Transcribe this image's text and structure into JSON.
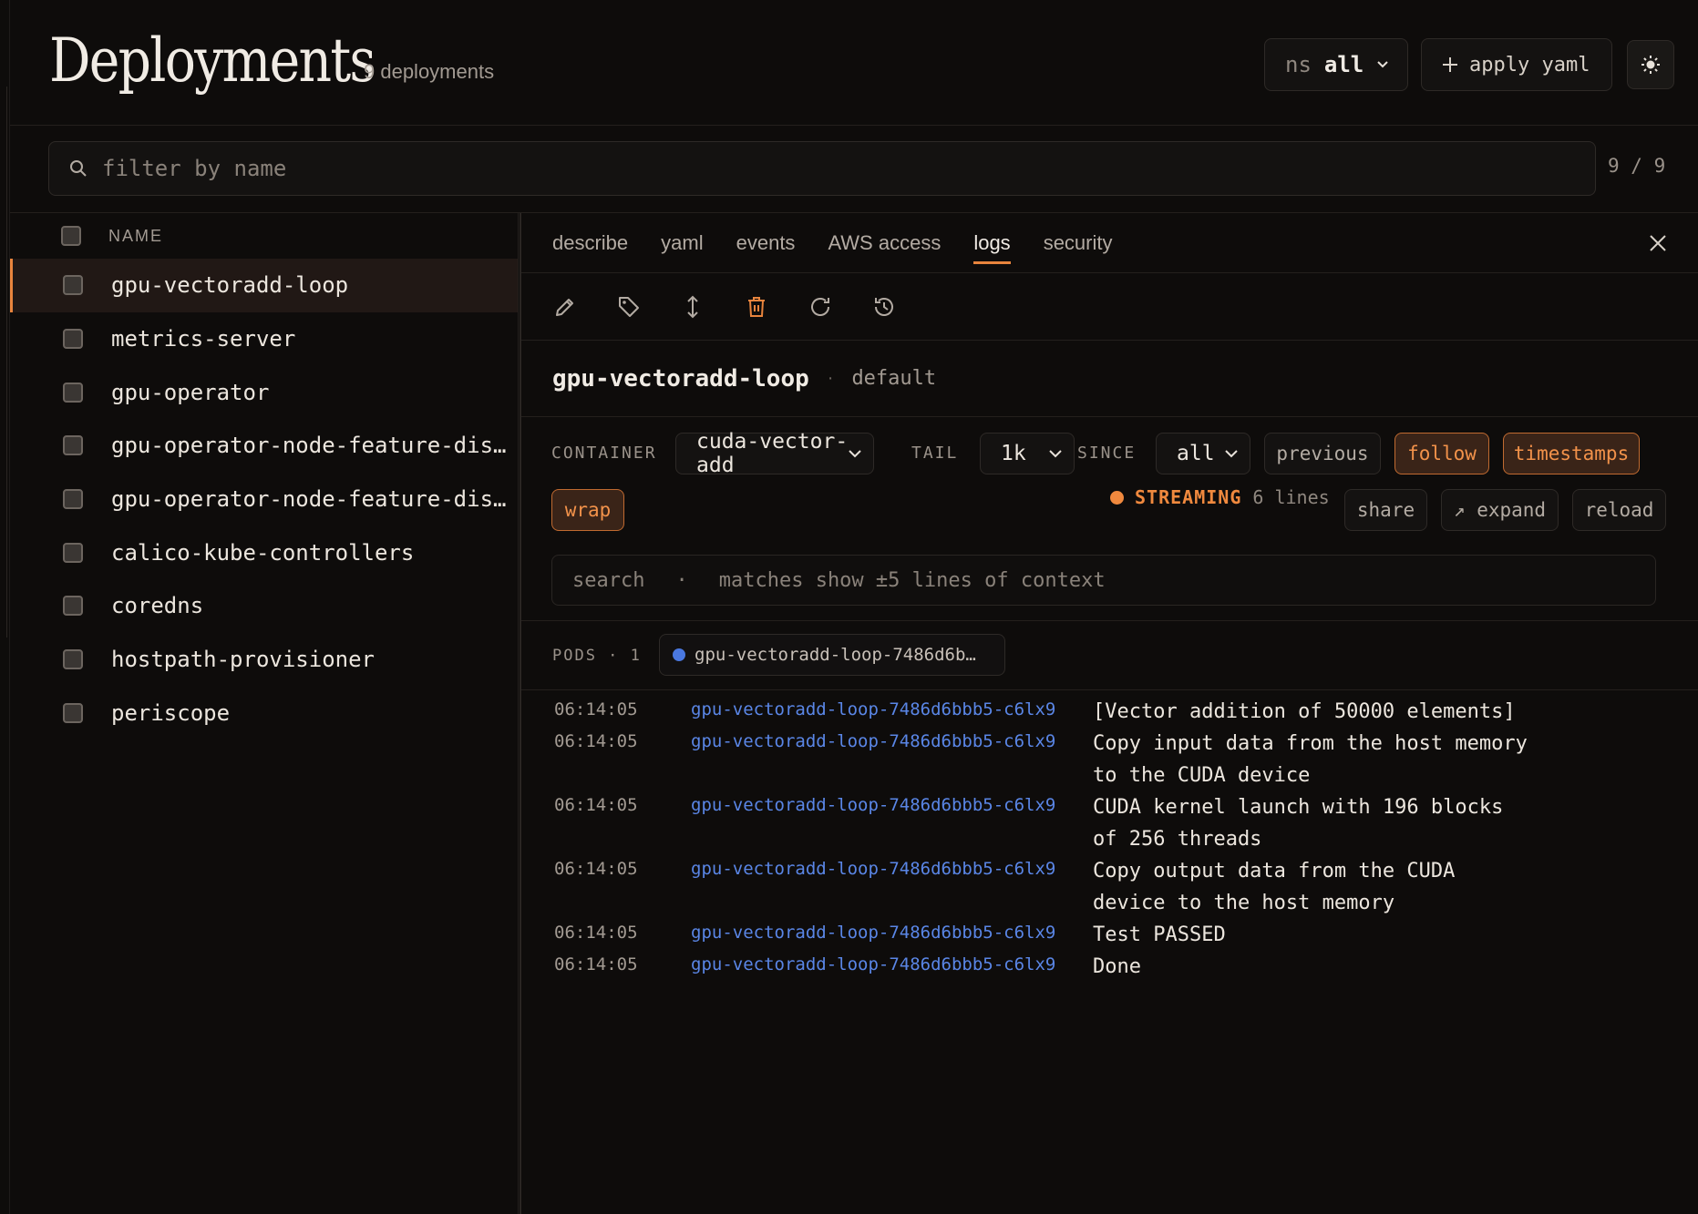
{
  "header": {
    "title": "Deployments",
    "count": "9 deployments",
    "ns_label": "ns",
    "ns_value": "all",
    "apply_label": "apply yaml",
    "theme_icon": "sun-icon"
  },
  "filter": {
    "placeholder": "filter by name",
    "count": "9 / 9"
  },
  "list": {
    "column": "NAME",
    "items": [
      {
        "label": "gpu-vectoradd-loop",
        "selected": true
      },
      {
        "label": "metrics-server"
      },
      {
        "label": "gpu-operator"
      },
      {
        "label": "gpu-operator-node-feature-disco…"
      },
      {
        "label": "gpu-operator-node-feature-disco…"
      },
      {
        "label": "calico-kube-controllers"
      },
      {
        "label": "coredns"
      },
      {
        "label": "hostpath-provisioner"
      },
      {
        "label": "periscope"
      }
    ]
  },
  "tabs": [
    "describe",
    "yaml",
    "events",
    "AWS access",
    "logs",
    "security"
  ],
  "active_tab": "logs",
  "toolbar": [
    "edit-icon",
    "tag-icon",
    "scale-icon",
    "delete-icon",
    "restart-icon",
    "history-icon"
  ],
  "resource": {
    "name": "gpu-vectoradd-loop",
    "sep": "·",
    "namespace": "default"
  },
  "controls": {
    "container_label": "CONTAINER",
    "container_value": "cuda-vector-add",
    "tail_label": "TAIL",
    "tail_value": "1k",
    "since_label": "SINCE",
    "since_value": "all",
    "previous": "previous",
    "follow": "follow",
    "timestamps": "timestamps",
    "wrap": "wrap",
    "streaming": "STREAMING",
    "lines": "6 lines",
    "share": "share",
    "expand": "↗ expand",
    "reload": "reload",
    "search_placeholder": "search",
    "search_sep": "·",
    "search_hint": "matches show ±5 lines of context"
  },
  "pods": {
    "label": "PODS · 1",
    "chip": "gpu-vectoradd-loop-7486d6b…"
  },
  "logs": [
    {
      "ts": "06:14:05",
      "pod": "gpu-vectoradd-loop-7486d6bbb5-c6lx9",
      "msg": "[Vector addition of 50000 elements]"
    },
    {
      "ts": "06:14:05",
      "pod": "gpu-vectoradd-loop-7486d6bbb5-c6lx9",
      "msg": "Copy input data from the host memory to the CUDA device"
    },
    {
      "ts": "06:14:05",
      "pod": "gpu-vectoradd-loop-7486d6bbb5-c6lx9",
      "msg": "CUDA kernel launch with 196 blocks of 256 threads"
    },
    {
      "ts": "06:14:05",
      "pod": "gpu-vectoradd-loop-7486d6bbb5-c6lx9",
      "msg": "Copy output data from the CUDA device to the host memory"
    },
    {
      "ts": "06:14:05",
      "pod": "gpu-vectoradd-loop-7486d6bbb5-c6lx9",
      "msg": "Test PASSED"
    },
    {
      "ts": "06:14:05",
      "pod": "gpu-vectoradd-loop-7486d6bbb5-c6lx9",
      "msg": "Done"
    }
  ],
  "colors": {
    "accent": "#e8843d",
    "pod_link": "#5a86e6",
    "background": "#0e0c0b"
  }
}
